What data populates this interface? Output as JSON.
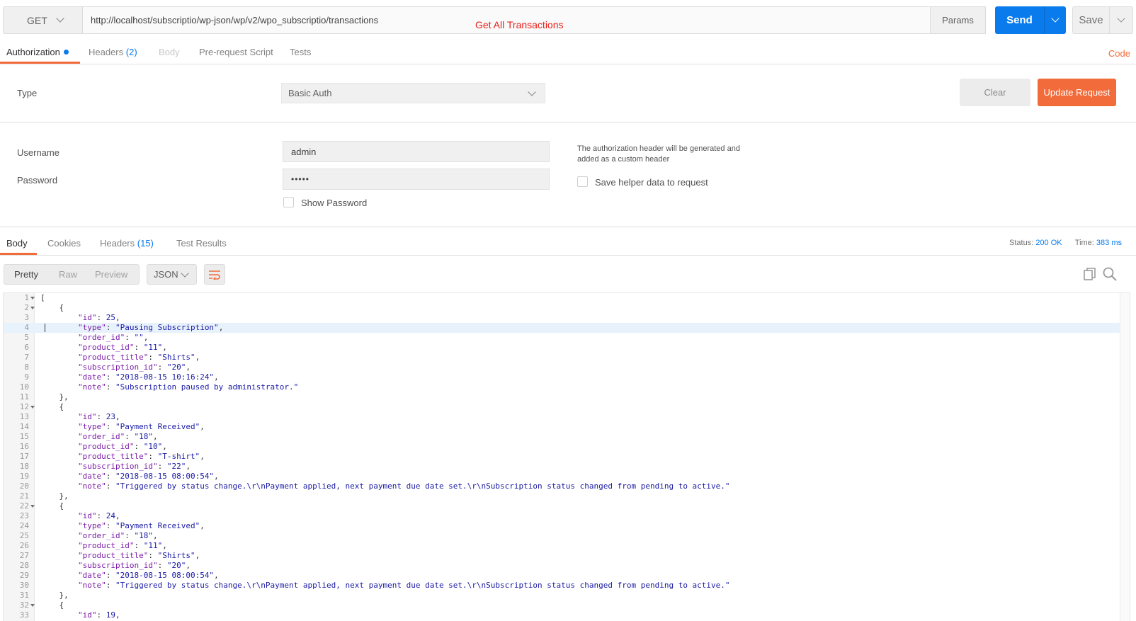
{
  "request": {
    "method": "GET",
    "url": "http://localhost/subscriptio/wp-json/wp/v2/wpo_subscriptio/transactions",
    "annotation": "Get All Transactions",
    "params_label": "Params",
    "send_label": "Send",
    "save_label": "Save"
  },
  "request_tabs": {
    "authorization": "Authorization",
    "headers": "Headers",
    "headers_count": "(2)",
    "body": "Body",
    "prerequest": "Pre-request Script",
    "tests": "Tests",
    "code": "Code"
  },
  "auth": {
    "type_label": "Type",
    "type_value": "Basic Auth",
    "clear_label": "Clear",
    "update_label": "Update Request",
    "username_label": "Username",
    "username_value": "admin",
    "password_label": "Password",
    "password_value": "•••••",
    "show_password_label": "Show Password",
    "help_text": "The authorization header will be generated and added as a custom header",
    "save_helper_label": "Save helper data to request"
  },
  "response_tabs": {
    "body": "Body",
    "cookies": "Cookies",
    "headers": "Headers",
    "headers_count": "(15)",
    "test_results": "Test Results",
    "status_label": "Status:",
    "status_value": "200 OK",
    "time_label": "Time:",
    "time_value": "383 ms"
  },
  "view": {
    "pretty": "Pretty",
    "raw": "Raw",
    "preview": "Preview",
    "format": "JSON"
  },
  "colors": {
    "accent_orange": "#f26b3a",
    "accent_blue": "#097bed"
  },
  "icons": [
    "chevron-down-icon",
    "wrap-lines-icon",
    "copy-icon",
    "search-icon",
    "fold-arrow-icon"
  ],
  "code_lines": [
    {
      "n": "1",
      "fold": true,
      "text": "["
    },
    {
      "n": "2",
      "fold": true,
      "text": "    {"
    },
    {
      "n": "3",
      "key": "\"id\"",
      "val": "25",
      "tail": ",",
      "indent": "        "
    },
    {
      "n": "4",
      "key": "\"type\"",
      "val": "\"Pausing Subscription\"",
      "tail": ",",
      "indent": "        ",
      "hl": true
    },
    {
      "n": "5",
      "key": "\"order_id\"",
      "val": "\"\"",
      "tail": ",",
      "indent": "        "
    },
    {
      "n": "6",
      "key": "\"product_id\"",
      "val": "\"11\"",
      "tail": ",",
      "indent": "        "
    },
    {
      "n": "7",
      "key": "\"product_title\"",
      "val": "\"Shirts\"",
      "tail": ",",
      "indent": "        "
    },
    {
      "n": "8",
      "key": "\"subscription_id\"",
      "val": "\"20\"",
      "tail": ",",
      "indent": "        "
    },
    {
      "n": "9",
      "key": "\"date\"",
      "val": "\"2018-08-15 10:16:24\"",
      "tail": ",",
      "indent": "        "
    },
    {
      "n": "10",
      "key": "\"note\"",
      "val": "\"Subscription paused by administrator.\"",
      "tail": "",
      "indent": "        "
    },
    {
      "n": "11",
      "text": "    },"
    },
    {
      "n": "12",
      "fold": true,
      "text": "    {"
    },
    {
      "n": "13",
      "key": "\"id\"",
      "val": "23",
      "tail": ",",
      "indent": "        "
    },
    {
      "n": "14",
      "key": "\"type\"",
      "val": "\"Payment Received\"",
      "tail": ",",
      "indent": "        "
    },
    {
      "n": "15",
      "key": "\"order_id\"",
      "val": "\"18\"",
      "tail": ",",
      "indent": "        "
    },
    {
      "n": "16",
      "key": "\"product_id\"",
      "val": "\"10\"",
      "tail": ",",
      "indent": "        "
    },
    {
      "n": "17",
      "key": "\"product_title\"",
      "val": "\"T-shirt\"",
      "tail": ",",
      "indent": "        "
    },
    {
      "n": "18",
      "key": "\"subscription_id\"",
      "val": "\"22\"",
      "tail": ",",
      "indent": "        "
    },
    {
      "n": "19",
      "key": "\"date\"",
      "val": "\"2018-08-15 08:00:54\"",
      "tail": ",",
      "indent": "        "
    },
    {
      "n": "20",
      "key": "\"note\"",
      "val": "\"Triggered by status change.\\r\\nPayment applied, next payment due date set.\\r\\nSubscription status changed from pending to active.\"",
      "tail": "",
      "indent": "        "
    },
    {
      "n": "21",
      "text": "    },"
    },
    {
      "n": "22",
      "fold": true,
      "text": "    {"
    },
    {
      "n": "23",
      "key": "\"id\"",
      "val": "24",
      "tail": ",",
      "indent": "        "
    },
    {
      "n": "24",
      "key": "\"type\"",
      "val": "\"Payment Received\"",
      "tail": ",",
      "indent": "        "
    },
    {
      "n": "25",
      "key": "\"order_id\"",
      "val": "\"18\"",
      "tail": ",",
      "indent": "        "
    },
    {
      "n": "26",
      "key": "\"product_id\"",
      "val": "\"11\"",
      "tail": ",",
      "indent": "        "
    },
    {
      "n": "27",
      "key": "\"product_title\"",
      "val": "\"Shirts\"",
      "tail": ",",
      "indent": "        "
    },
    {
      "n": "28",
      "key": "\"subscription_id\"",
      "val": "\"20\"",
      "tail": ",",
      "indent": "        "
    },
    {
      "n": "29",
      "key": "\"date\"",
      "val": "\"2018-08-15 08:00:54\"",
      "tail": ",",
      "indent": "        "
    },
    {
      "n": "30",
      "key": "\"note\"",
      "val": "\"Triggered by status change.\\r\\nPayment applied, next payment due date set.\\r\\nSubscription status changed from pending to active.\"",
      "tail": "",
      "indent": "        "
    },
    {
      "n": "31",
      "text": "    },"
    },
    {
      "n": "32",
      "fold": true,
      "text": "    {"
    },
    {
      "n": "33",
      "key": "\"id\"",
      "val": "19",
      "tail": ",",
      "indent": "        "
    }
  ]
}
